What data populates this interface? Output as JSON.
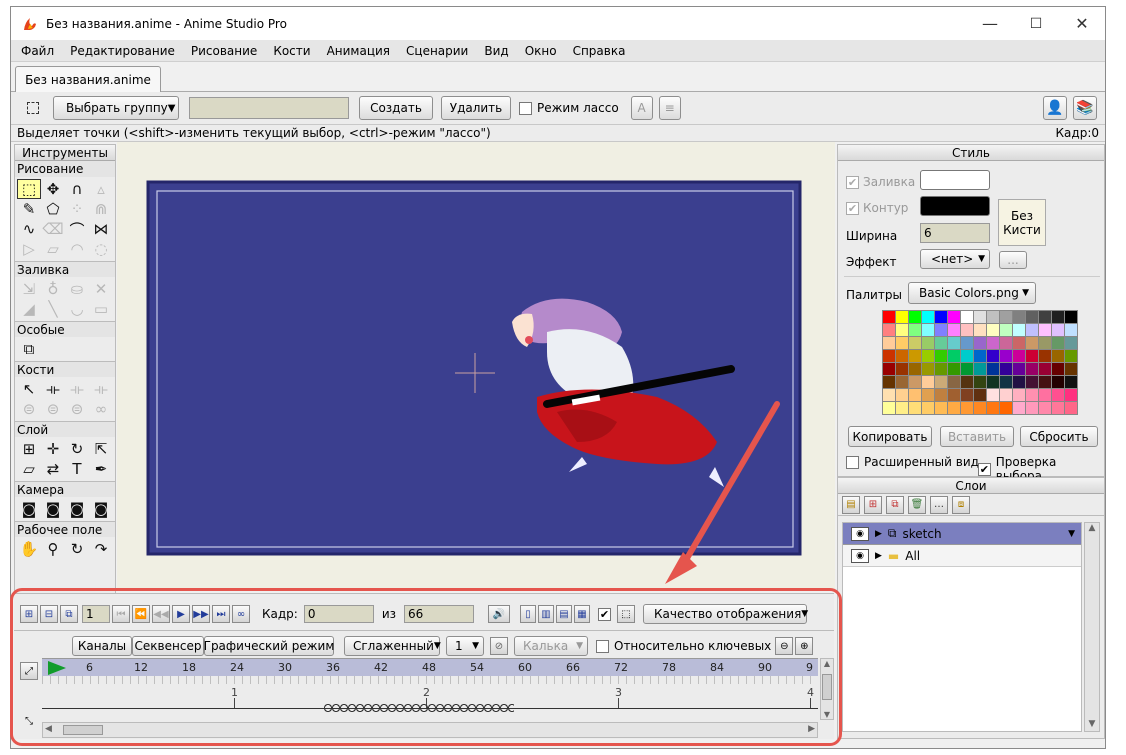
{
  "window": {
    "title": "Без названия.anime - Anime Studio Pro",
    "controls": [
      "—",
      "☐",
      "✕"
    ]
  },
  "menu": [
    "Файл",
    "Редактирование",
    "Рисование",
    "Кости",
    "Анимация",
    "Сценарии",
    "Вид",
    "Окно",
    "Справка"
  ],
  "doc_tab": "Без названия.anime",
  "tool_options": {
    "select_group": "Выбрать группу",
    "group_name_value": "",
    "create": "Создать",
    "delete": "Удалить",
    "lasso_mode": "Режим лассо"
  },
  "status": {
    "hint": "Выделяет точки (<shift>-изменить текущий выбор, <ctrl>-режим \"лассо\")",
    "frame": "Кадр:0"
  },
  "tools": {
    "title": "Инструменты",
    "sections": {
      "draw": "Рисование",
      "fill": "Заливка",
      "special": "Особые",
      "bones": "Кости",
      "layer": "Слой",
      "camera": "Камера",
      "workspace": "Рабочее поле"
    }
  },
  "style": {
    "title": "Стиль",
    "fill_label": "Заливка",
    "stroke_label": "Контур",
    "width_label": "Ширина",
    "width_value": "6",
    "effect_label": "Эффект",
    "effect_value": "<нет>",
    "brush_button": "Без Кисти",
    "dots_button": "...",
    "palette_label": "Палитры",
    "palette_value": "Basic Colors.png",
    "copy": "Копировать",
    "paste": "Вставить",
    "reset": "Сбросить",
    "advanced_view": "Расширенный вид",
    "check_selection": "Проверка выбора",
    "fill_color": "#ffffff",
    "stroke_color": "#000000"
  },
  "palette_colors": [
    [
      "#ff0000",
      "#ffff00",
      "#00ff00",
      "#00ffff",
      "#0000ff",
      "#ff00ff",
      "#ffffff",
      "#e0e0e0",
      "#c0c0c0",
      "#a0a0a0",
      "#808080",
      "#606060",
      "#404040",
      "#202020",
      "#000000"
    ],
    [
      "#ff8080",
      "#ffff80",
      "#80ff80",
      "#80ffff",
      "#8080ff",
      "#ff80ff",
      "#ffc0c0",
      "#ffe0c0",
      "#ffffc0",
      "#c0ffc0",
      "#c0ffff",
      "#c0c0ff",
      "#ffc0ff",
      "#e0c0ff",
      "#c0e0ff"
    ],
    [
      "#ffcc99",
      "#ffcc66",
      "#cccc66",
      "#99cc66",
      "#66cc99",
      "#66cccc",
      "#6699cc",
      "#9966cc",
      "#cc66cc",
      "#cc6699",
      "#cc6666",
      "#cc9966",
      "#999966",
      "#669966",
      "#669999"
    ],
    [
      "#cc3300",
      "#cc6600",
      "#cc9900",
      "#99cc00",
      "#33cc00",
      "#00cc66",
      "#00cccc",
      "#0066cc",
      "#3300cc",
      "#9900cc",
      "#cc0099",
      "#cc0033",
      "#993300",
      "#996600",
      "#669900"
    ],
    [
      "#990000",
      "#993300",
      "#996600",
      "#999900",
      "#669900",
      "#339900",
      "#009933",
      "#009999",
      "#003399",
      "#330099",
      "#660099",
      "#990066",
      "#990033",
      "#660000",
      "#663300"
    ],
    [
      "#663300",
      "#996633",
      "#cc9966",
      "#ffcc99",
      "#ccaa77",
      "#886644",
      "#553311",
      "#334411",
      "#113322",
      "#113344",
      "#221144",
      "#441133",
      "#441111",
      "#220000",
      "#111111"
    ],
    [
      "#ffe0b0",
      "#ffd090",
      "#ffc070",
      "#e0a050",
      "#c08040",
      "#a06030",
      "#804020",
      "#603010",
      "#ffe0e0",
      "#ffd0d0",
      "#ffb0c0",
      "#ff90b0",
      "#ff70a0",
      "#ff5090",
      "#ff3080"
    ],
    [
      "#ffff99",
      "#ffee88",
      "#ffdd77",
      "#ffcc66",
      "#ffbb55",
      "#ffaa44",
      "#ff9933",
      "#ff8822",
      "#ff7711",
      "#ff6600",
      "#ffaacc",
      "#ff99bb",
      "#ff88aa",
      "#ff7799",
      "#ff6688"
    ]
  ],
  "layers": {
    "title": "Слои",
    "items": [
      {
        "name": "sketch",
        "selected": true
      },
      {
        "name": "All",
        "selected": false
      }
    ]
  },
  "timeline": {
    "frame_label": "Кадр:",
    "frame_value": "0",
    "of_label": "из",
    "total_frames": "66",
    "start_value": "1",
    "display_quality": "Качество отображения",
    "tabs": [
      "Каналы",
      "Секвенсер",
      "Графический режим"
    ],
    "interp": "Сглаженный",
    "interp_num": "1",
    "keys": "Калька",
    "relative_keys": "Относительно ключевых",
    "ruler": [
      "6",
      "12",
      "18",
      "24",
      "30",
      "36",
      "42",
      "48",
      "54",
      "60",
      "66",
      "72",
      "78",
      "84",
      "90",
      "9"
    ],
    "seconds": [
      "1",
      "2",
      "3",
      "4"
    ]
  },
  "colors": {
    "canvas_bg": "#3b3f8f",
    "accent": "#e5554d",
    "layer_selected": "#7b7fbf"
  }
}
